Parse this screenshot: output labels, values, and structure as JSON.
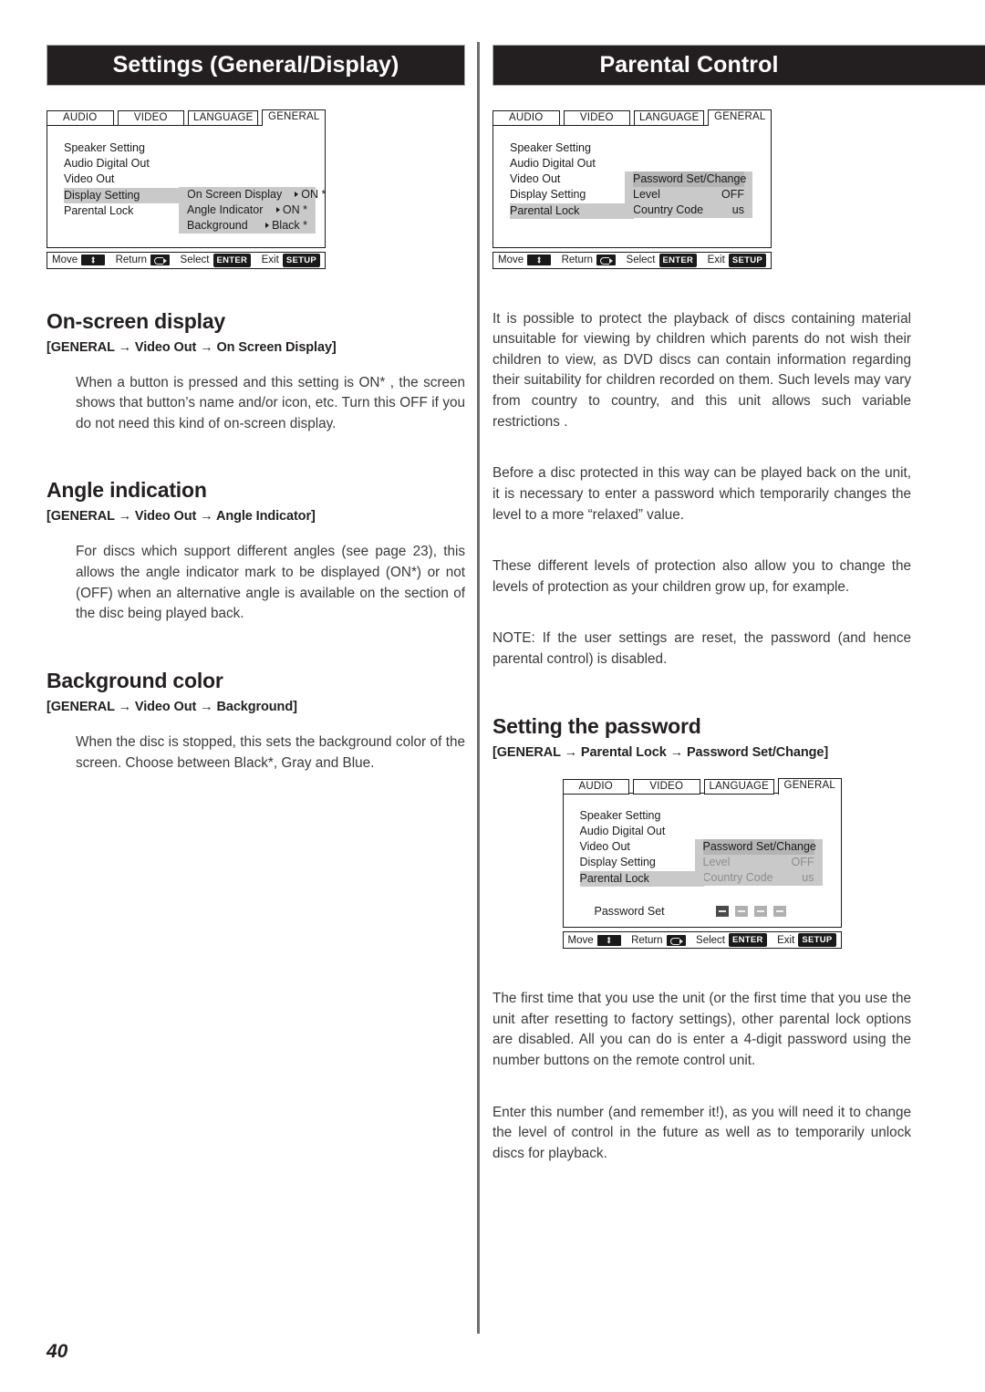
{
  "page": {
    "number": "40",
    "left_header": "Settings (General/Display)",
    "right_header": "Parental Control"
  },
  "osd_common": {
    "tabs": [
      "AUDIO",
      "VIDEO",
      "LANGUAGE",
      "GENERAL"
    ],
    "active_tab": "GENERAL",
    "menu_items": [
      "Speaker Setting",
      "Audio Digital Out",
      "Video Out",
      "Display Setting",
      "Parental Lock"
    ],
    "footer": {
      "move_label": "Move",
      "move_icon": "dpad-icon",
      "return_label": "Return",
      "return_icon": "return-arrow-icon",
      "select_label": "Select",
      "select_key": "ENTER",
      "exit_label": "Exit",
      "exit_key": "SETUP"
    }
  },
  "osd_display": {
    "highlighted_item": "Display Setting",
    "submenu": [
      {
        "label": "On Screen Display",
        "value": "ON *",
        "caret": true
      },
      {
        "label": "Angle Indicator",
        "value": "ON *",
        "caret": true
      },
      {
        "label": "Background",
        "value": "Black *",
        "caret": true
      }
    ]
  },
  "osd_parental": {
    "highlighted_item": "Parental Lock",
    "submenu": [
      {
        "label": "Password Set/Change",
        "value": "",
        "selected": true
      },
      {
        "label": "Level",
        "value": "OFF"
      },
      {
        "label": "Country Code",
        "value": "us"
      }
    ]
  },
  "osd_password": {
    "highlighted_item": "Parental Lock",
    "submenu": [
      {
        "label": "Password Set/Change",
        "value": "",
        "selected": true
      },
      {
        "label": "Level",
        "value": "OFF",
        "dim": true
      },
      {
        "label": "Country Code",
        "value": "us",
        "dim": true
      }
    ],
    "password_set_label": "Password Set",
    "password_digits": 4,
    "active_digit_index": 0
  },
  "left_column": {
    "sections": [
      {
        "title": "On-screen display",
        "path_parts": [
          "GENERAL",
          "Video Out",
          "On Screen Display"
        ],
        "path": "[GENERAL → Video Out → On Screen Display]",
        "body": "When a button is pressed and this setting is ON* , the screen shows that button’s name and/or icon, etc. Turn this OFF if you do not need this kind of on-screen display."
      },
      {
        "title": "Angle indication",
        "path": "[GENERAL → Video Out → Angle Indicator]",
        "body": "For discs which support different angles (see page 23), this allows the angle indicator mark to be displayed (ON*) or not (OFF) when an alternative angle is available on the section of the disc being played back."
      },
      {
        "title": "Background color",
        "path": "[GENERAL → Video Out → Background]",
        "body": "When the disc is stopped, this sets the background color of the screen. Choose between Black*, Gray and Blue."
      }
    ]
  },
  "right_column": {
    "intro_paragraphs": [
      "It is possible to protect the playback of discs containing material unsuitable for viewing by children which parents do not wish their children to view, as DVD discs can contain information regarding their suitability for children recorded on them. Such levels may vary from country to country, and this unit allows such variable restrictions .",
      "Before a disc protected in this way can be played back on the unit, it is necessary to enter a password which temporarily changes the level to a more “relaxed” value.",
      "These different levels of protection also allow you to change the levels of protection as your children grow up, for example.",
      "NOTE: If the user settings are reset, the password (and hence parental control) is disabled."
    ],
    "password_section": {
      "title": "Setting the password",
      "path": "[GENERAL → Parental Lock → Password Set/Change]"
    },
    "outro_paragraphs": [
      "The first time that you use the unit (or the first time that you use the unit after resetting to factory settings), other parental lock options are disabled. All you can do is enter a 4-digit password using the number buttons on the remote control unit.",
      "Enter this number (and remember it!), as you will need it to change the level of control in the future as well as to temporarily unlock discs for playback."
    ]
  }
}
